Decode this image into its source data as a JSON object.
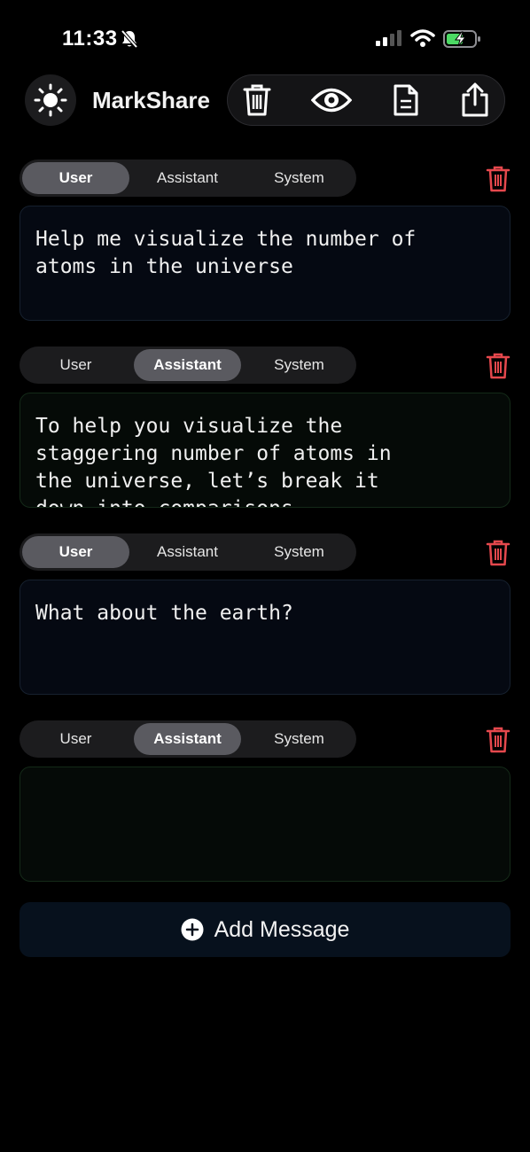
{
  "status_bar": {
    "time": "11:33",
    "icons": [
      "bell-slash-icon",
      "cellular-signal-icon",
      "wifi-icon",
      "battery-charging-icon"
    ],
    "battery_color": "#4cd964"
  },
  "header": {
    "title": "MarkShare",
    "theme_icon": "sun-icon",
    "toolbar_icons": [
      "trash-icon",
      "eye-icon",
      "document-icon",
      "share-icon"
    ]
  },
  "role_options": [
    "User",
    "Assistant",
    "System"
  ],
  "messages": [
    {
      "role": "User",
      "text": "Help me visualize the number of\natoms in the universe"
    },
    {
      "role": "Assistant",
      "text": "To help you visualize the\nstaggering number of atoms in\nthe universe, let’s break it\ndown into comparisons"
    },
    {
      "role": "User",
      "text": "What about the earth?"
    },
    {
      "role": "Assistant",
      "text": ""
    }
  ],
  "add_button": {
    "label": "Add Message",
    "icon": "plus-circle-icon"
  },
  "colors": {
    "delete": "#e5484d",
    "selected_segment": "#5a5a60",
    "background": "#000000"
  }
}
